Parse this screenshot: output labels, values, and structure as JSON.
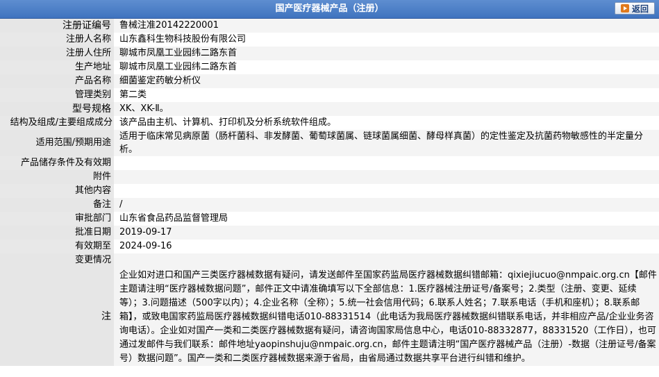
{
  "header": {
    "title": "国产医疗器械产品（注册）",
    "back_label": "返回"
  },
  "rows": [
    {
      "label": "注册证编号",
      "value": "鲁械注准20142220001"
    },
    {
      "label": "注册人名称",
      "value": "山东鑫科生物科技股份有限公司"
    },
    {
      "label": "注册人住所",
      "value": "聊城市凤凰工业园纬二路东首"
    },
    {
      "label": "生产地址",
      "value": "聊城市凤凰工业园纬二路东首"
    },
    {
      "label": "产品名称",
      "value": "细菌鉴定药敏分析仪"
    },
    {
      "label": "管理类别",
      "value": "第二类"
    },
    {
      "label": "型号规格",
      "value": "XK、XK-Ⅱ。"
    },
    {
      "label": "结构及组成/主要组成成分",
      "value": "该产品由主机、计算机、打印机及分析系统软件组成。"
    },
    {
      "label": "适用范围/预期用途",
      "value": "适用于临床常见病原菌（肠杆菌科、非发酵菌、葡萄球菌属、链球菌属细菌、酵母样真菌）的定性鉴定及抗菌药物敏感性的半定量分析。"
    },
    {
      "label": "产品储存条件及有效期",
      "value": ""
    },
    {
      "label": "附件",
      "value": ""
    },
    {
      "label": "其他内容",
      "value": ""
    },
    {
      "label": "备注",
      "value": "/"
    },
    {
      "label": "审批部门",
      "value": "山东省食品药品监督管理局"
    },
    {
      "label": "批准日期",
      "value": "2019-09-17"
    },
    {
      "label": "有效期至",
      "value": "2024-09-16"
    },
    {
      "label": "变更情况",
      "value": ""
    }
  ],
  "note": {
    "label": "注",
    "text": "企业如对进口和国产三类医疗器械数据有疑问，请发送邮件至国家药监局医疗器械数据纠错邮箱：qixiejiucuo@nmpaic.org.cn【邮件主题请注明“医疗器械数据问题”，邮件正文中请准确填写以下全部信息：1.医疗器械注册证号/备案号；2.类型（注册、变更、延续等）；3.问题描述（500字以内）；4.企业名称（全称）；5.统一社会信用代码；6.联系人姓名；7.联系电话（手机和座机）；8.联系邮箱】，或致电国家药监局医疗器械数据纠错电话010-88331514（此电话为我局医疗器械数据纠错联系电话，并非相应产品/企业业务咨询电话）。企业如对国产一类和二类医疗器械数据有疑问，请咨询国家局信息中心，电话010-88332877，88331520（工作日），也可通过发邮件与我们联系：邮件地址yaopinshuju@nmpaic.org.cn，邮件主题请注明“国产医疗器械产品（注册）-数据（注册证号/备案号）数据问题”。国产一类和二类医疗器械数据来源于省局，由省局通过数据共享平台进行纠错和维护。"
  },
  "colors": {
    "header_bg": "#4a7cc6",
    "label_bg": "#e8e8e8",
    "row_alt_bg": "#f4f4f4"
  }
}
